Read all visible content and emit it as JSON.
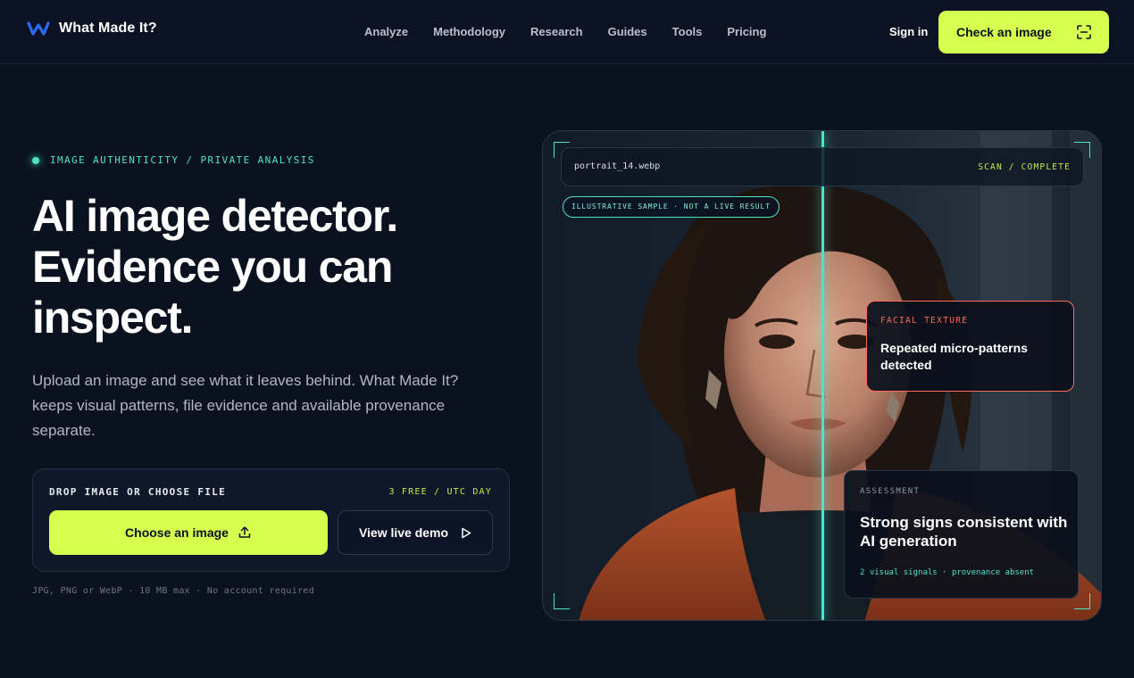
{
  "nav": {
    "brand": "What Made It?",
    "links": [
      "Analyze",
      "Methodology",
      "Research",
      "Guides",
      "Tools",
      "Pricing"
    ],
    "signin": "Sign in",
    "cta": "Check an image"
  },
  "hero": {
    "eyebrow": "IMAGE AUTHENTICITY / PRIVATE ANALYSIS",
    "headline": "AI image detector. Evidence you can inspect.",
    "lede": "Upload an image and see what it leaves behind. What Made It? keeps visual patterns, file evidence and available provenance separate.",
    "drop_label": "DROP IMAGE OR CHOOSE FILE",
    "quota": "3 FREE / UTC DAY",
    "choose_button": "Choose an image",
    "demo_button": "View live demo",
    "fine_print": "JPG, PNG or WebP · 10 MB max · No account required"
  },
  "preview": {
    "filename": "portrait_14.webp",
    "status": "SCAN / COMPLETE",
    "sample_pill": "ILLUSTRATIVE SAMPLE · NOT A LIVE RESULT",
    "signal_label": "FACIAL TEXTURE",
    "signal_text": "Repeated micro-patterns detected",
    "assessment_label": "ASSESSMENT",
    "assessment_text": "Strong signs consistent with AI generation",
    "assessment_meta": "2 visual signals · provenance absent"
  },
  "colors": {
    "accent": "#d5ff4f",
    "teal": "#4ee3c8",
    "alert": "#ff6b5c",
    "background": "#0a1220"
  }
}
